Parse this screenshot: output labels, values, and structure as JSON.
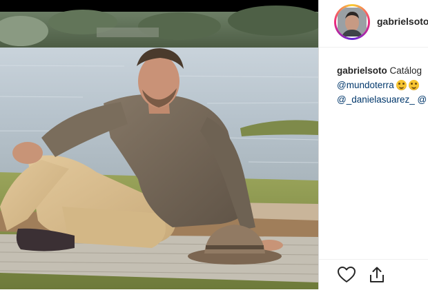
{
  "post": {
    "username": "gabrielsoto",
    "caption": {
      "author": "gabrielsoto",
      "text": "Catálog",
      "line2_mention": "@mundoterra",
      "line3_mention": "@_danielasuarez_",
      "line3_trailing": "@"
    }
  },
  "icons": {
    "like": "heart-icon",
    "share": "share-icon",
    "emoji": "grinning-squinting-face-emoji"
  },
  "colors": {
    "text": "#262626",
    "link": "#00376b",
    "divider": "#efefef",
    "avatar_ring_gradient": [
      "#f9ce34",
      "#ee2a7b",
      "#6228d7"
    ]
  }
}
